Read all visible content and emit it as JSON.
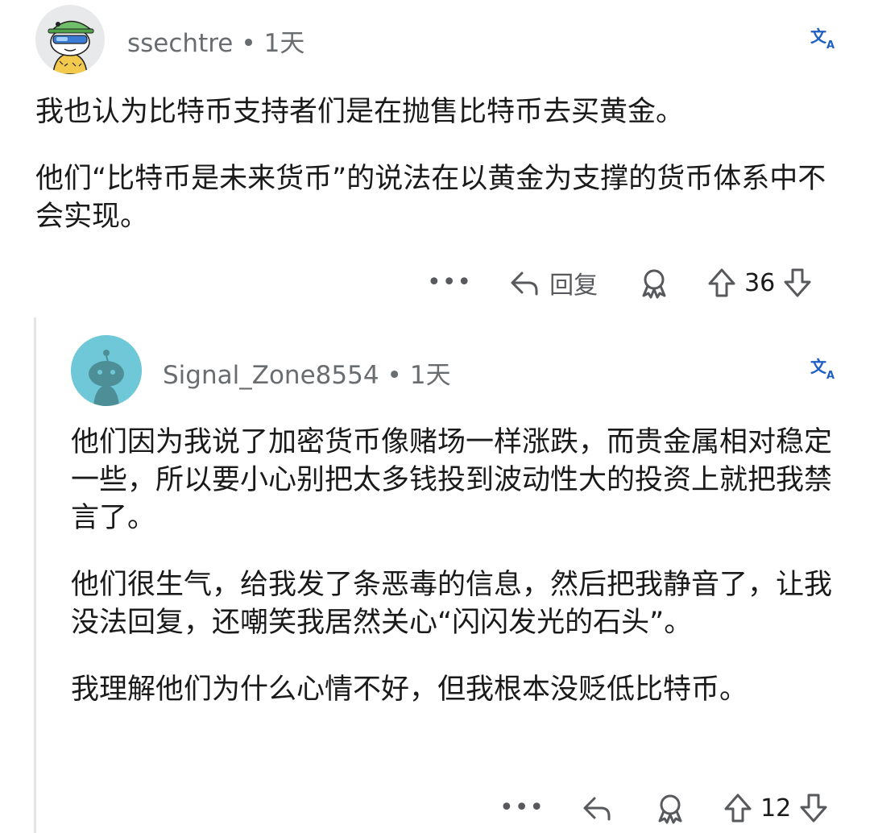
{
  "comments": [
    {
      "author": "ssechtre",
      "separator": "•",
      "time": "1天",
      "avatar_icon": "snoo-avatar-sunglasses-icon",
      "paragraphs": [
        "我也认为比特币支持者们是在抛售比特币去买黄金。",
        "他们“比特币是未来货币”的说法在以黄金为支撑的货币体系中不会实现。"
      ],
      "actions": {
        "more_label": "•••",
        "reply_label": "回复",
        "vote_count": "36"
      }
    },
    {
      "author": "Signal_Zone8554",
      "separator": "•",
      "time": "1天",
      "avatar_icon": "default-snoo-avatar-icon",
      "paragraphs": [
        "他们因为我说了加密货币像赌场一样涨跌，而贵金属相对稳定一些，所以要小心别把太多钱投到波动性大的投资上就把我禁言了。",
        "他们很生气，给我发了条恶毒的信息，然后把我静音了，让我没法回复，还嘲笑我居然关心“闪闪发光的石头”。",
        "我理解他们为什么心情不好，但我根本没贬低比特币。"
      ],
      "actions": {
        "more_label": "•••",
        "vote_count": "12"
      }
    }
  ],
  "colors": {
    "text": "#1a1a1b",
    "meta": "#6a6d70",
    "icon": "#57595c",
    "translate": "#1d5fc4",
    "thread_line": "#e3e5e7",
    "avatar2_bg": "#6fc8d7"
  }
}
